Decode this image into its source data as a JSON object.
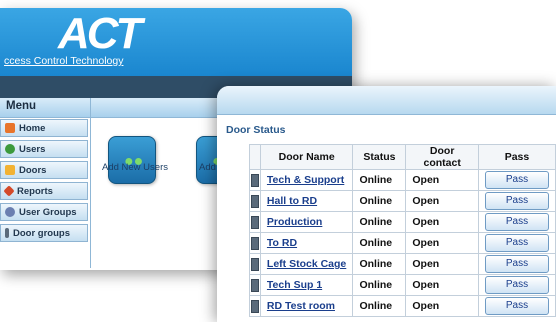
{
  "app": {
    "logo": "ACT",
    "tagline": "ccess Control Technology"
  },
  "menu": {
    "title": "Menu",
    "items": [
      {
        "label": "Home",
        "icon": "home-icon",
        "color": "#e8742a"
      },
      {
        "label": "Users",
        "icon": "users-icon",
        "color": "#3c9a3c"
      },
      {
        "label": "Doors",
        "icon": "door-icon",
        "color": "#f2b233"
      },
      {
        "label": "Reports",
        "icon": "reports-icon",
        "color": "#d44a2a"
      },
      {
        "label": "User Groups",
        "icon": "user-groups-icon",
        "color": "#6b7fb0"
      },
      {
        "label": "Door groups",
        "icon": "door-groups-icon",
        "color": "#5a6a7a"
      }
    ]
  },
  "tiles": [
    {
      "label": "Add New Users",
      "icon": "add-users-icon"
    },
    {
      "label": "Add",
      "icon": "add-icon"
    }
  ],
  "door_status": {
    "title": "Door Status",
    "columns": [
      "Door Name",
      "Status",
      "Door contact",
      "Pass"
    ],
    "rows": [
      {
        "name": "Tech & Support",
        "status": "Online",
        "contact": "Open",
        "action": "Pass"
      },
      {
        "name": "Hall to RD",
        "status": "Online",
        "contact": "Open",
        "action": "Pass"
      },
      {
        "name": "Production",
        "status": "Online",
        "contact": "Open",
        "action": "Pass"
      },
      {
        "name": "To RD",
        "status": "Online",
        "contact": "Open",
        "action": "Pass"
      },
      {
        "name": "Left Stock Cage",
        "status": "Online",
        "contact": "Open",
        "action": "Pass"
      },
      {
        "name": "Tech Sup 1",
        "status": "Online",
        "contact": "Open",
        "action": "Pass"
      },
      {
        "name": "RD Test room",
        "status": "Online",
        "contact": "Open",
        "action": "Pass"
      }
    ]
  },
  "colors": {
    "header_blue": "#1a86cf",
    "dark_band": "#2f4d66",
    "link_blue": "#1a3e8c"
  }
}
